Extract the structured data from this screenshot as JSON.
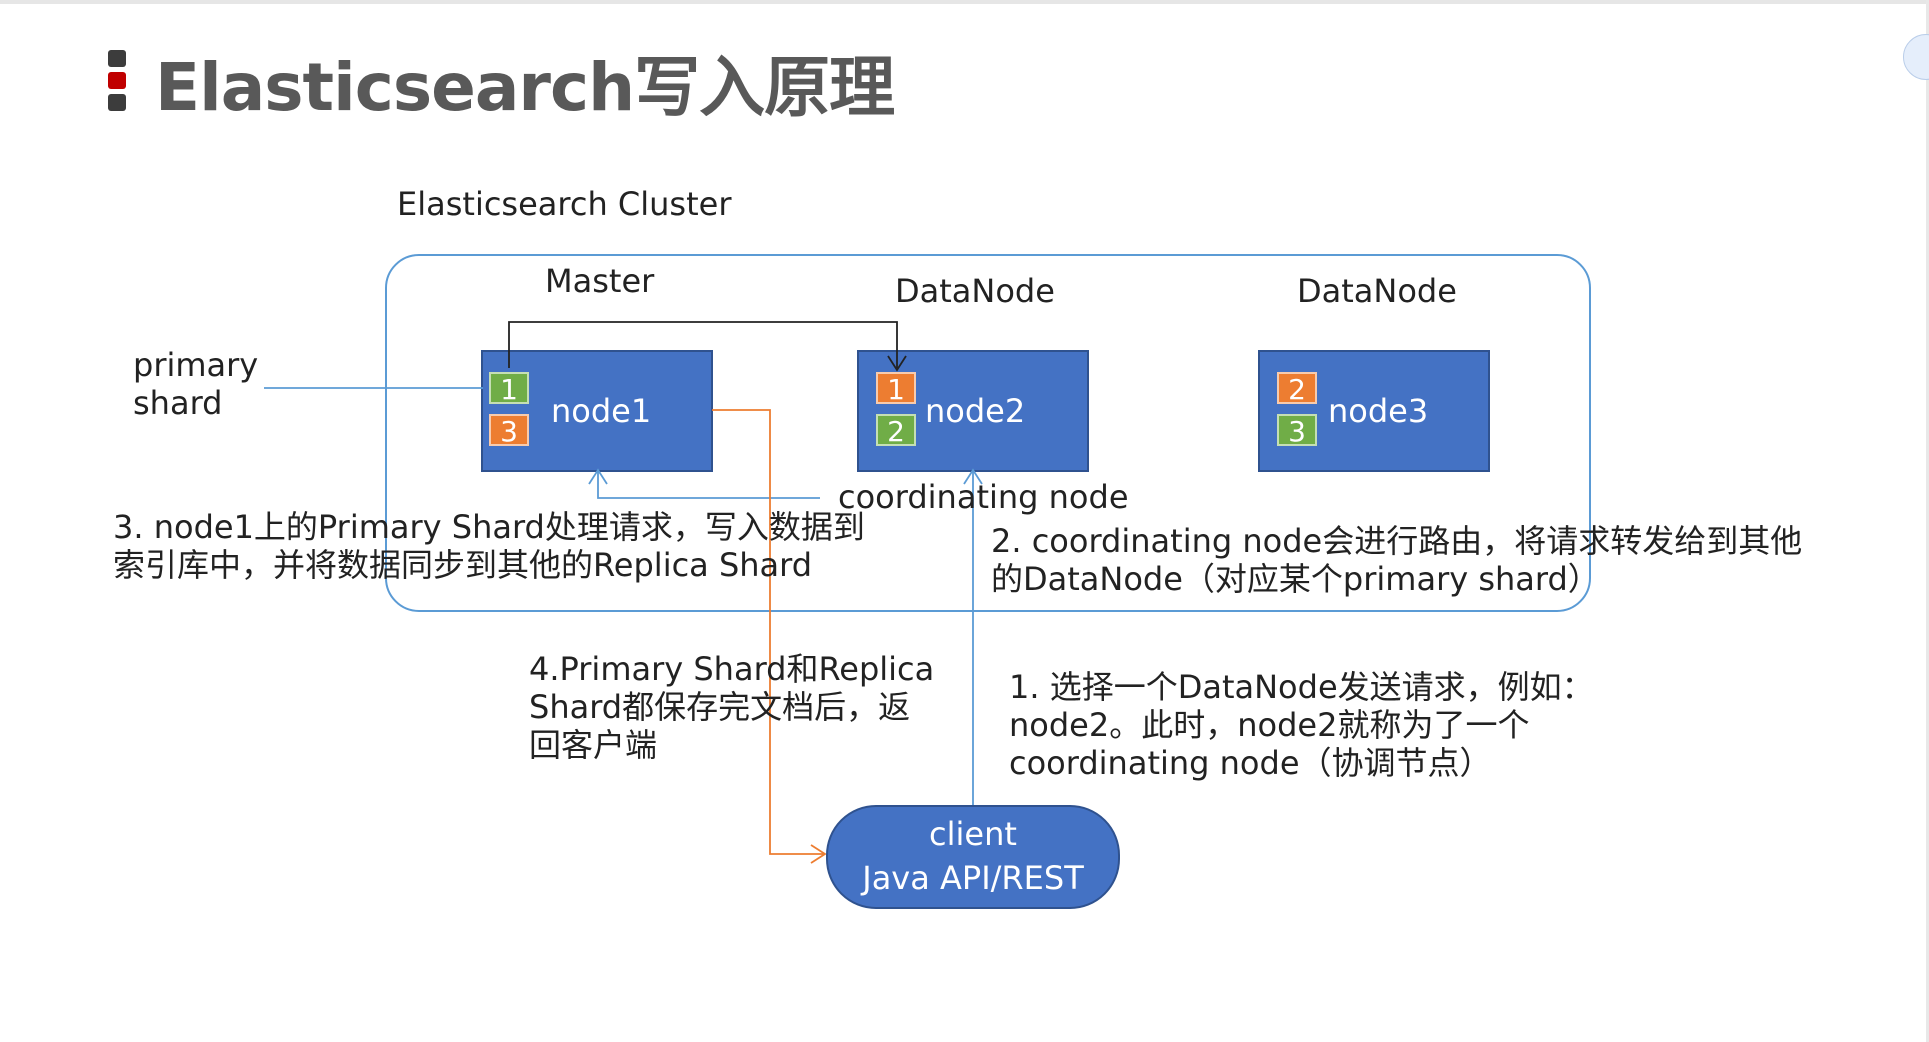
{
  "title": "Elasticsearch写入原理",
  "cluster_label": "Elasticsearch Cluster",
  "role_labels": {
    "master": "Master",
    "datanode2": "DataNode",
    "datanode3": "DataNode"
  },
  "nodes": [
    {
      "name": "node1",
      "shards": [
        {
          "id": "1",
          "type": "primary"
        },
        {
          "id": "3",
          "type": "replica"
        }
      ]
    },
    {
      "name": "node2",
      "shards": [
        {
          "id": "1",
          "type": "replica"
        },
        {
          "id": "2",
          "type": "primary"
        }
      ]
    },
    {
      "name": "node3",
      "shards": [
        {
          "id": "2",
          "type": "replica"
        },
        {
          "id": "3",
          "type": "primary"
        }
      ]
    }
  ],
  "primary_shard_label": [
    "primary",
    "shard"
  ],
  "coordinating_node_label": "coordinating node",
  "client": {
    "line1": "client",
    "line2": "Java API/REST"
  },
  "steps": {
    "step1": [
      "1. 选择一个DataNode发送请求，例如：",
      "node2。此时，node2就称为了一个",
      "coordinating node（协调节点）"
    ],
    "step2": [
      "2. coordinating node会进行路由，将请求转发给到其他",
      "的DataNode（对应某个primary shard）"
    ],
    "step3": [
      "3. node1上的Primary Shard处理请求，写入数据到",
      "索引库中，并将数据同步到其他的Replica Shard"
    ],
    "step4": [
      "4.Primary Shard和Replica",
      "Shard都保存完文档后，返",
      "回客户端"
    ]
  },
  "colors": {
    "node_fill": "#4472c4",
    "primary_shard": "#70ad47",
    "replica_shard": "#ed7d31",
    "cluster_border": "#5b9bd5",
    "response_line": "#ed7d31",
    "request_line": "#5b9bd5"
  }
}
